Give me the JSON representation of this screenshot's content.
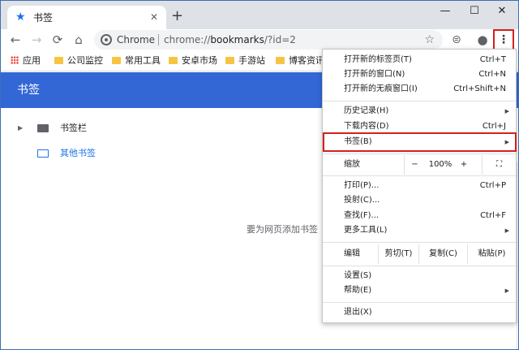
{
  "tab": {
    "title": "书签",
    "close": "✕"
  },
  "window": {
    "minimize": "—",
    "maximize": "☐",
    "close": "✕",
    "new_tab": "+"
  },
  "toolbar": {
    "back": "←",
    "forward": "→",
    "reload": "⟳",
    "home": "⌂",
    "site_label": "Chrome",
    "url_prefix": "chrome://",
    "url_host": "bookmarks",
    "url_path": "/?id=2",
    "bookmark_star": "☆",
    "menu_dots": "⋮"
  },
  "bookmarks_bar": {
    "apps_label": "应用",
    "items": [
      "公司监控",
      "常用工具",
      "安卓市场",
      "手游站",
      "博客资讯"
    ]
  },
  "page": {
    "title": "书签",
    "tree": [
      {
        "label": "书签栏"
      },
      {
        "label": "其他书签"
      }
    ],
    "empty_message": "要为网页添加书签"
  },
  "menu": {
    "new_tab": {
      "label": "打开新的标签页(T)",
      "shortcut": "Ctrl+T"
    },
    "new_window": {
      "label": "打开新的窗口(N)",
      "shortcut": "Ctrl+N"
    },
    "incognito": {
      "label": "打开新的无痕窗口(I)",
      "shortcut": "Ctrl+Shift+N"
    },
    "history": {
      "label": "历史记录(H)"
    },
    "downloads": {
      "label": "下载内容(D)",
      "shortcut": "Ctrl+J"
    },
    "bookmarks": {
      "label": "书签(B)"
    },
    "zoom": {
      "label": "缩放",
      "minus": "−",
      "value": "100%",
      "plus": "+",
      "fullscreen": "⛶"
    },
    "print": {
      "label": "打印(P)...",
      "shortcut": "Ctrl+P"
    },
    "cast": {
      "label": "投射(C)..."
    },
    "find": {
      "label": "查找(F)...",
      "shortcut": "Ctrl+F"
    },
    "more_tools": {
      "label": "更多工具(L)"
    },
    "edit": {
      "label": "编辑",
      "cut": "剪切(T)",
      "copy": "复制(C)",
      "paste": "粘贴(P)"
    },
    "settings": {
      "label": "设置(S)"
    },
    "help": {
      "label": "帮助(E)"
    },
    "exit": {
      "label": "退出(X)"
    },
    "submenu_arrow": "▶"
  },
  "colors": {
    "accent": "#1a73e8",
    "header_blue": "#3367d6",
    "highlight_border": "#d32020"
  }
}
